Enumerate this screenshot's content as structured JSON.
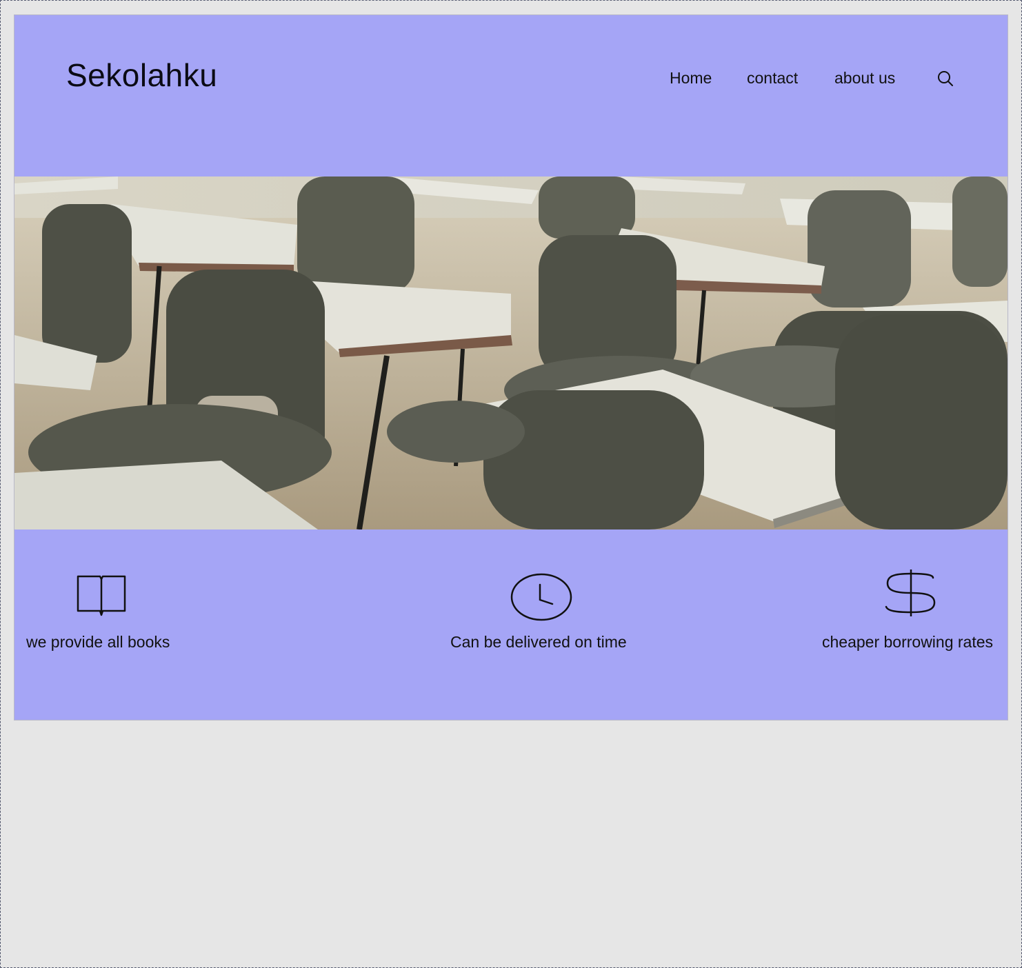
{
  "header": {
    "brand": "Sekolahku",
    "nav": [
      {
        "label": "Home"
      },
      {
        "label": "contact"
      },
      {
        "label": "about us"
      }
    ],
    "search_icon": "search-icon"
  },
  "hero": {
    "image": "classroom-desks-photo"
  },
  "features": [
    {
      "icon": "book-icon",
      "label": "we provide all books"
    },
    {
      "icon": "clock-icon",
      "label": "Can be delivered on time"
    },
    {
      "icon": "dollar-icon",
      "label": "cheaper borrowing rates"
    }
  ],
  "colors": {
    "page_background": "#a5a5f6",
    "canvas_background": "#e6e6e6",
    "text": "#111111"
  }
}
